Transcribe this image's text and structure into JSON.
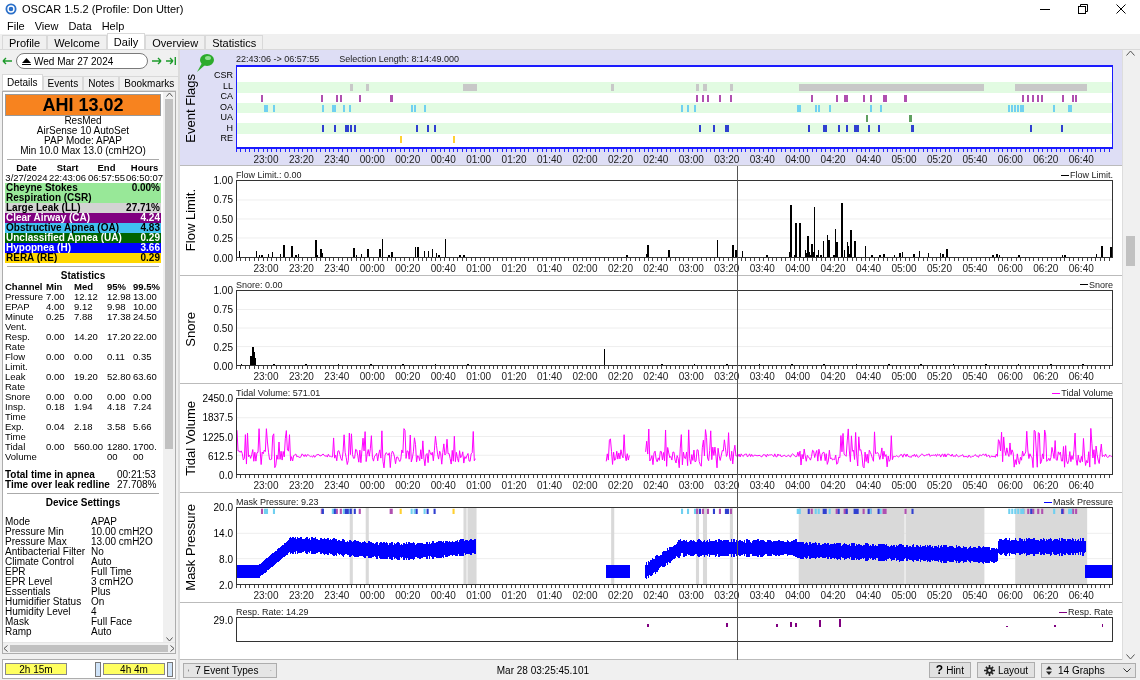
{
  "window": {
    "title": "OSCAR 1.5.2 (Profile: Don Utter)"
  },
  "menu": [
    "File",
    "View",
    "Data",
    "Help"
  ],
  "tabs": [
    {
      "label": "Profile",
      "selected": false
    },
    {
      "label": "Welcome",
      "selected": false
    },
    {
      "label": "Daily",
      "selected": true
    },
    {
      "label": "Overview",
      "selected": false
    },
    {
      "label": "Statistics",
      "selected": false
    }
  ],
  "date_nav": {
    "date": "Wed Mar 27 2024"
  },
  "sidebar": {
    "tabs": [
      {
        "label": "Details",
        "selected": true
      },
      {
        "label": "Events",
        "selected": false
      },
      {
        "label": "Notes",
        "selected": false
      },
      {
        "label": "Bookmarks",
        "selected": false
      }
    ],
    "ahi": "AHI 13.02",
    "machine": [
      "ResMed",
      "AirSense 10 AutoSet",
      "PAP Mode: APAP",
      "Min 10.0 Max 13.0 (cmH2O)"
    ],
    "session_columns": [
      "Date",
      "Start",
      "End",
      "Hours"
    ],
    "session": [
      "3/27/2024",
      "22:43:06",
      "06:57:55",
      "06:50:07"
    ],
    "indices": [
      {
        "label": "Cheyne Stokes Respiration (CSR)",
        "value": "0.00%",
        "color": "#98e898"
      },
      {
        "label": "Large Leak (LL)",
        "value": "27.71%",
        "color": "#d3d3d3"
      },
      {
        "label": "Clear Airway (CA)",
        "value": "4.24",
        "color": "#800080"
      },
      {
        "label": "Obstructive Apnea (OA)",
        "value": "4.83",
        "color": "#40c0f0"
      },
      {
        "label": "Unclassified Apnea (UA)",
        "value": "0.29",
        "color": "#006400"
      },
      {
        "label": "Hypopnea (H)",
        "value": "3.66",
        "color": "#0000ff"
      },
      {
        "label": "RERA (RE)",
        "value": "0.29",
        "color": "#ffd700"
      }
    ],
    "statistics": {
      "title": "Statistics",
      "columns": [
        "Channel",
        "Min",
        "Med",
        "95%",
        "99.5%"
      ],
      "rows": [
        [
          "Pressure",
          "7.00",
          "12.12",
          "12.98",
          "13.00"
        ],
        [
          "EPAP",
          "4.00",
          "9.12",
          "9.98",
          "10.00"
        ],
        [
          "Minute Vent.",
          "0.25",
          "7.88",
          "17.38",
          "24.50"
        ],
        [
          "Resp. Rate",
          "0.00",
          "14.20",
          "17.20",
          "22.00"
        ],
        [
          "Flow Limit.",
          "0.00",
          "0.00",
          "0.11",
          "0.35"
        ],
        [
          "Leak Rate",
          "0.00",
          "19.20",
          "52.80",
          "63.60"
        ],
        [
          "Snore",
          "0.00",
          "0.00",
          "0.00",
          "0.00"
        ],
        [
          "Insp. Time",
          "0.18",
          "1.94",
          "4.18",
          "7.24"
        ],
        [
          "Exp. Time",
          "0.04",
          "2.18",
          "3.58",
          "5.66"
        ],
        [
          "Tidal Volume",
          "0.00",
          "560.00",
          "1280.00",
          "1700.00"
        ]
      ]
    },
    "totals": [
      {
        "label": "Total time in apnea",
        "value": "00:21:53"
      },
      {
        "label": "Time over leak redline",
        "value": "27.708%"
      }
    ],
    "device_settings": {
      "title": "Device Settings",
      "rows": [
        {
          "label": "Mode",
          "value": "APAP"
        },
        {
          "label": "Pressure Min",
          "value": "10.00 cmH2O"
        },
        {
          "label": "Pressure Max",
          "value": "13.00 cmH2O"
        },
        {
          "label": "Antibacterial Filter",
          "value": "No"
        },
        {
          "label": "Climate Control",
          "value": "Auto"
        },
        {
          "label": "EPR",
          "value": "Full Time"
        },
        {
          "label": "EPR Level",
          "value": "3 cmH2O"
        },
        {
          "label": "Essentials",
          "value": "Plus"
        },
        {
          "label": "Humidifier Status",
          "value": "On"
        },
        {
          "label": "Humidity Level",
          "value": "4"
        },
        {
          "label": "Mask",
          "value": "Full Face"
        },
        {
          "label": "Ramp",
          "value": "Auto"
        }
      ]
    },
    "durations": [
      "2h 15m",
      "4h 4m"
    ]
  },
  "event_flags": {
    "title": "Event Flags",
    "range": "22:43:06 -> 06:57:55",
    "selection": "Selection Length: 8:14:49.000",
    "rows": [
      {
        "label": "CSR"
      },
      {
        "label": "LL",
        "color": "#c8c8c8"
      },
      {
        "label": "CA",
        "color": "#b050b0"
      },
      {
        "label": "OA",
        "color": "#70d0f0"
      },
      {
        "label": "UA",
        "color": "#60a060"
      },
      {
        "label": "H",
        "color": "#3040d0"
      },
      {
        "label": "RE",
        "color": "#ffd030"
      }
    ],
    "x_ticks": [
      "23:00",
      "23:20",
      "23:40",
      "00:00",
      "00:20",
      "00:40",
      "01:00",
      "01:20",
      "01:40",
      "02:00",
      "02:20",
      "02:40",
      "03:00",
      "03:20",
      "03:40",
      "04:00",
      "04:20",
      "04:40",
      "05:00",
      "05:20",
      "05:40",
      "06:00",
      "06:20",
      "06:40"
    ]
  },
  "graphs": [
    {
      "kind": "spikes",
      "title": "Flow Limit.",
      "reading": "Flow Limit.: 0.00",
      "legend": "Flow Limit.",
      "color": "#000000",
      "y_ticks": [
        "1.00",
        "0.75",
        "0.50",
        "0.25",
        "0.00"
      ],
      "x_ticks": [
        "23:00",
        "23:20",
        "23:40",
        "00:00",
        "00:20",
        "00:40",
        "01:00",
        "01:20",
        "01:40",
        "02:00",
        "02:20",
        "02:40",
        "03:00",
        "03:20",
        "03:40",
        "04:00",
        "04:20",
        "04:40",
        "05:00",
        "05:20",
        "05:40",
        "06:00",
        "06:20",
        "06:40"
      ]
    },
    {
      "kind": "snore",
      "title": "Snore",
      "reading": "Snore: 0.00",
      "legend": "Snore",
      "color": "#000000",
      "y_ticks": [
        "1.00",
        "0.75",
        "0.50",
        "0.25",
        "0.00"
      ],
      "x_ticks": [
        "23:00",
        "23:20",
        "23:40",
        "00:00",
        "00:20",
        "00:40",
        "01:00",
        "01:20",
        "01:40",
        "02:00",
        "02:20",
        "02:40",
        "03:00",
        "03:20",
        "03:40",
        "04:00",
        "04:20",
        "04:40",
        "05:00",
        "05:20",
        "05:40",
        "06:00",
        "06:20",
        "06:40"
      ]
    },
    {
      "kind": "wave",
      "title": "Tidal Volume",
      "reading": "Tidal Volume: 571.01",
      "legend": "Tidal Volume",
      "color": "#ff00ff",
      "y_ticks": [
        "2450.0",
        "1837.5",
        "1225.0",
        "612.5",
        "0.0"
      ],
      "x_ticks": [
        "23:00",
        "23:20",
        "23:40",
        "00:00",
        "00:20",
        "00:40",
        "01:00",
        "01:20",
        "01:40",
        "02:00",
        "02:20",
        "02:40",
        "03:00",
        "03:20",
        "03:40",
        "04:00",
        "04:20",
        "04:40",
        "05:00",
        "05:20",
        "05:40",
        "06:00",
        "06:20",
        "06:40"
      ]
    },
    {
      "kind": "band",
      "title": "Mask Pressure",
      "reading": "Mask Pressure: 9.23",
      "legend": "Mask Pressure",
      "color": "#0000ff",
      "y_ticks": [
        "20.0",
        "14.0",
        "8.0",
        "2.0"
      ],
      "x_ticks": [
        "23:00",
        "23:20",
        "23:40",
        "00:00",
        "00:20",
        "00:40",
        "01:00",
        "01:20",
        "01:40",
        "02:00",
        "02:20",
        "02:40",
        "03:00",
        "03:20",
        "03:40",
        "04:00",
        "04:20",
        "04:40",
        "05:00",
        "05:20",
        "05:40",
        "06:00",
        "06:20",
        "06:40"
      ]
    },
    {
      "kind": "rate",
      "reading": "Resp. Rate: 14.29",
      "legend": "Resp. Rate",
      "color": "#800080",
      "y_ticks": [
        "29.0"
      ]
    }
  ],
  "status_bar": {
    "event_types": "7 Event Types",
    "time": "Mar 28 03:25:45.101",
    "hint_icon": "?",
    "hint": "Hint",
    "layout": "Layout",
    "graphs": "14 Graphs"
  }
}
